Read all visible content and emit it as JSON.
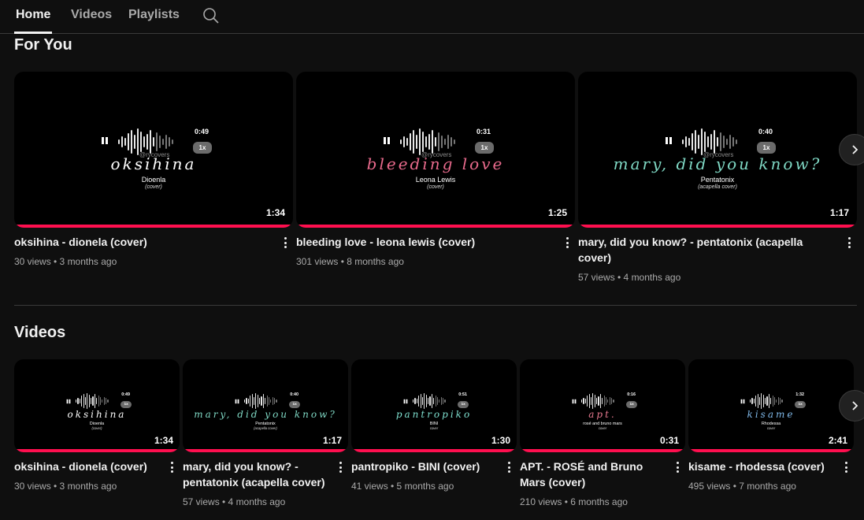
{
  "tabs": [
    {
      "label": "Home"
    },
    {
      "label": "Videos"
    },
    {
      "label": "Playlists"
    }
  ],
  "sections": {
    "for_you": {
      "title": "For You",
      "videos": [
        {
          "title": "oksihina - dionela (cover)",
          "meta": "30 views • 3 months ago",
          "duration": "1:34",
          "thumb": {
            "script": "oksihina",
            "artist": "Dioenla",
            "sub": "(cover)",
            "time": "0:49",
            "speed": "1x",
            "watermark": "@rycovers",
            "color": "#ffffff"
          }
        },
        {
          "title": "bleeding love - leona lewis (cover)",
          "meta": "301 views • 8 months ago",
          "duration": "1:25",
          "thumb": {
            "script": "bleeding love",
            "artist": "Leona Lewis",
            "sub": "(cover)",
            "time": "0:31",
            "speed": "1x",
            "watermark": "@rycovers",
            "color": "#e86a8c"
          }
        },
        {
          "title": "mary, did you know? - pentatonix (acapella cover)",
          "meta": "57 views • 4 months ago",
          "duration": "1:17",
          "thumb": {
            "script": "mary, did you know?",
            "artist": "Pentatonix",
            "sub": "(acapella cover)",
            "time": "0:40",
            "speed": "1x",
            "watermark": "@rycovers",
            "color": "#7fd8c4"
          }
        }
      ]
    },
    "videos": {
      "title": "Videos",
      "videos": [
        {
          "title": "oksihina - dionela (cover)",
          "meta": "30 views • 3 months ago",
          "duration": "1:34",
          "thumb": {
            "script": "oksihina",
            "artist": "Dioenla",
            "sub": "(cover)",
            "time": "0:49",
            "speed": "1x",
            "color": "#ffffff"
          }
        },
        {
          "title": "mary, did you know? - pentatonix (acapella cover)",
          "meta": "57 views • 4 months ago",
          "duration": "1:17",
          "thumb": {
            "script": "mary, did you know?",
            "artist": "Pentatonix",
            "sub": "(acapella cover)",
            "time": "0:40",
            "speed": "1x",
            "color": "#7fd8c4"
          }
        },
        {
          "title": "pantropiko - BINI (cover)",
          "meta": "41 views • 5 months ago",
          "duration": "1:30",
          "thumb": {
            "script": "pantropiko",
            "artist": "BINI",
            "sub": "cover",
            "time": "0:51",
            "speed": "1x",
            "color": "#7fe0d0"
          }
        },
        {
          "title": "APT. - ROSÉ and Bruno Mars (cover)",
          "meta": "210 views • 6 months ago",
          "duration": "0:31",
          "thumb": {
            "script": "apt.",
            "artist": "rosé and bruno mars",
            "sub": "cover",
            "time": "0:16",
            "speed": "1x",
            "color": "#e87a90"
          }
        },
        {
          "title": "kisame - rhodessa (cover)",
          "meta": "495 views • 7 months ago",
          "duration": "2:41",
          "thumb": {
            "script": "kisame",
            "artist": "Rhodessa",
            "sub": "cover",
            "time": "1:32",
            "speed": "1x",
            "color": "#7fb8e8"
          }
        }
      ]
    }
  },
  "colors": {
    "progress": "#ff0f4f",
    "background": "#0f0f0f"
  },
  "icons": {
    "search": "search-icon",
    "next": "chevron-right-icon",
    "menu": "more-vert-icon"
  }
}
